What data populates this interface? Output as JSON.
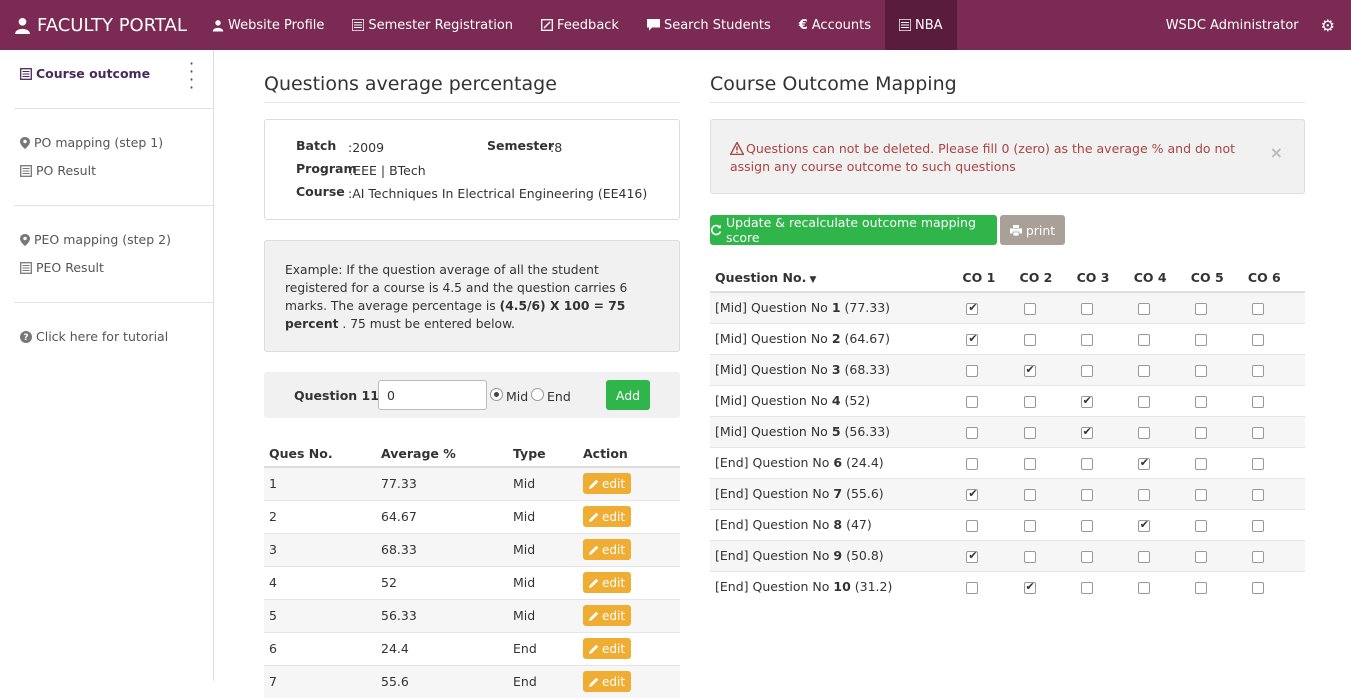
{
  "navbar": {
    "brand": "FACULTY PORTAL",
    "items": [
      {
        "label": "Website Profile",
        "icon": "user-icon"
      },
      {
        "label": "Semester Registration",
        "icon": "list-icon"
      },
      {
        "label": "Feedback",
        "icon": "edit-icon"
      },
      {
        "label": "Search Students",
        "icon": "comment-icon"
      },
      {
        "label": "Accounts",
        "icon": "euro-icon"
      },
      {
        "label": "NBA",
        "icon": "list-icon"
      }
    ],
    "active": "NBA",
    "user": "WSDC Administrator",
    "accent": "#7a2a53"
  },
  "sidebar": {
    "course_outcome": "Course outcome",
    "po_mapping": "PO mapping (step 1)",
    "po_result": "PO Result",
    "peo_mapping": "PEO mapping (step 2)",
    "peo_result": "PEO Result",
    "tutorial": "Click here for tutorial"
  },
  "left": {
    "title": "Questions average percentage",
    "info": {
      "batch_label": "Batch",
      "batch_value": ":2009",
      "semester_label": "Semester",
      "semester_value": ":8",
      "program_label": "Program",
      "program_value": ":EEE | BTech",
      "course_label": "Course",
      "course_value": ":AI Techniques In Electrical Engineering (EE416)"
    },
    "example": {
      "text1": "Example: If the question average of all the student registered for a course is 4.5 and the question carries 6 marks. The average percentage is ",
      "bold": "(4.5/6) X 100 = 75 percent",
      "text2": " . 75 must be entered below."
    },
    "form": {
      "label": "Question 11 :",
      "value": "0",
      "mid_label": "Mid",
      "end_label": "End",
      "add_label": "Add"
    },
    "table": {
      "headers": [
        "Ques No.",
        "Average %",
        "Type",
        "Action"
      ],
      "edit_label": "edit",
      "rows": [
        {
          "no": "1",
          "avg": "77.33",
          "type": "Mid"
        },
        {
          "no": "2",
          "avg": "64.67",
          "type": "Mid"
        },
        {
          "no": "3",
          "avg": "68.33",
          "type": "Mid"
        },
        {
          "no": "4",
          "avg": "52",
          "type": "Mid"
        },
        {
          "no": "5",
          "avg": "56.33",
          "type": "Mid"
        },
        {
          "no": "6",
          "avg": "24.4",
          "type": "End"
        },
        {
          "no": "7",
          "avg": "55.6",
          "type": "End"
        }
      ]
    }
  },
  "right": {
    "title": "Course Outcome Mapping",
    "alert": "Questions can not be deleted. Please fill 0 (zero) as the average % and do not assign any course outcome to such questions",
    "update_label": "Update & recalculate outcome mapping score",
    "print_label": "print",
    "table": {
      "q_header": "Question No.",
      "co_headers": [
        "CO 1",
        "CO 2",
        "CO 3",
        "CO 4",
        "CO 5",
        "CO 6"
      ],
      "q_word": "Question No",
      "rows": [
        {
          "type": "[Mid]",
          "num": "1",
          "avg": "(77.33)",
          "checks": [
            1,
            0,
            0,
            0,
            0,
            0
          ]
        },
        {
          "type": "[Mid]",
          "num": "2",
          "avg": "(64.67)",
          "checks": [
            1,
            0,
            0,
            0,
            0,
            0
          ]
        },
        {
          "type": "[Mid]",
          "num": "3",
          "avg": "(68.33)",
          "checks": [
            0,
            1,
            0,
            0,
            0,
            0
          ]
        },
        {
          "type": "[Mid]",
          "num": "4",
          "avg": "(52)",
          "checks": [
            0,
            0,
            1,
            0,
            0,
            0
          ]
        },
        {
          "type": "[Mid]",
          "num": "5",
          "avg": "(56.33)",
          "checks": [
            0,
            0,
            1,
            0,
            0,
            0
          ]
        },
        {
          "type": "[End]",
          "num": "6",
          "avg": "(24.4)",
          "checks": [
            0,
            0,
            0,
            1,
            0,
            0
          ]
        },
        {
          "type": "[End]",
          "num": "7",
          "avg": "(55.6)",
          "checks": [
            1,
            0,
            0,
            0,
            0,
            0
          ]
        },
        {
          "type": "[End]",
          "num": "8",
          "avg": "(47)",
          "checks": [
            0,
            0,
            0,
            1,
            0,
            0
          ]
        },
        {
          "type": "[End]",
          "num": "9",
          "avg": "(50.8)",
          "checks": [
            1,
            0,
            0,
            0,
            0,
            0
          ]
        },
        {
          "type": "[End]",
          "num": "10",
          "avg": "(31.2)",
          "checks": [
            0,
            1,
            0,
            0,
            0,
            0
          ]
        }
      ]
    }
  }
}
